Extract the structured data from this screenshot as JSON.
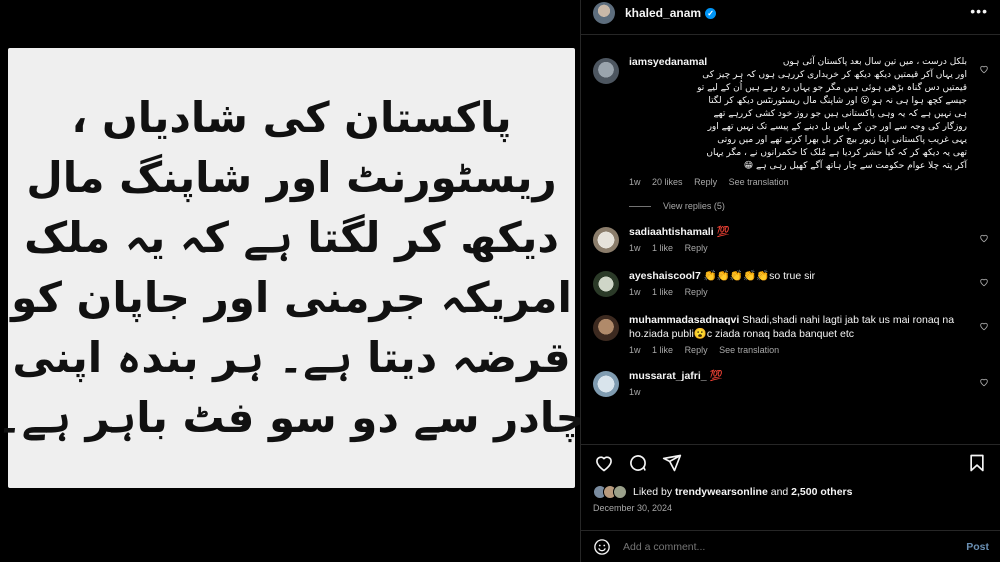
{
  "post": {
    "urdu_lines": [
      "پاکستان کی شادیاں ،",
      "ریسٹورنٹ اور شاپنگ مال",
      "دیکھ کر لگتا ہے کہ یہ ملک",
      "امریکہ جرمنی اور جاپان کو",
      "قرضہ دیتا ہے۔ ہر بندہ اپنی",
      "چادر سے دو سو فٹ باہر ہے۔"
    ]
  },
  "header": {
    "username": "khaled_anam",
    "verified_glyph": "✓",
    "more_glyph": "•••"
  },
  "comments": [
    {
      "user": "iamsyedanamal",
      "lines": [
        "بلکل درست ، میں تین سال بعد پاکستان آئی ہوں",
        "اور یہاں آکر قیمتیں دیکھ دیکھ کر خریداری کررہی ہوں کہ ہر چیز کی",
        "قیمتیں دس گناہ بڑھی ہوئی ہیں مگر جو یہاں رہ رہے ہیں اُن کے لیے تو",
        "جیسے کچھ ہوا ہی نہ ہو 😮 اور شاپنگ مال ریسٹورنٹس دیکھ کر لگتا",
        "ہی نہیں ہے کہ یہ وہی پاکستانی ہیں جو روز خود کشی کررہے تھے",
        "روزگار کی وجہ سے اور جن کے پاس بل دینے کے پیسے تک نہیں تھے اور",
        "یہی غریب پاکستانی اپنا زیور بیچ کر بل بھرا کرتے تھے اور میں روتی",
        "تھی یہ دیکھ کر کہ کیا حشر کردیا ہے مُلک کا حکمرانوں نے ، مگر یہاں",
        "آکر پتہ چلا عوام حکومت سے چار ہاتھ آگے کھیل رہی ہے 😁"
      ],
      "time": "1w",
      "likes": "20 likes",
      "reply": "Reply",
      "translation": "See translation",
      "view_replies": "View replies (5)"
    },
    {
      "user": "sadiaahtishamali",
      "text": "💯",
      "time": "1w",
      "likes": "1 like",
      "reply": "Reply"
    },
    {
      "user": "ayeshaiscool7",
      "text": "👏👏👏👏👏so true sir",
      "time": "1w",
      "likes": "1 like",
      "reply": "Reply"
    },
    {
      "user": "muhammadasadnaqvi",
      "text": "Shadi,shadi nahi lagti jab tak us mai ronaq na ho.ziada publi😮c ziada ronaq bada banquet etc",
      "time": "1w",
      "likes": "1 like",
      "reply": "Reply",
      "translation": "See translation"
    },
    {
      "user": "mussarat_jafri_",
      "text": "💯",
      "time": "1w",
      "likes": "",
      "reply": ""
    }
  ],
  "actions": {
    "like_icon": "heart-icon",
    "comment_icon": "comment-icon",
    "share_icon": "share-icon",
    "save_icon": "bookmark-icon"
  },
  "likes": {
    "prefix": "Liked by ",
    "user": "trendywearsonline",
    "middle": " and ",
    "others": "2,500 others"
  },
  "date": "December 30, 2024",
  "add_comment": {
    "placeholder": "Add a comment...",
    "post_label": "Post"
  },
  "colors": {
    "background": "#000000",
    "image_background": "#efefef",
    "verified": "#0095f6",
    "secondary_text": "#a8a8a8",
    "post_button": "#6a8fb3"
  }
}
